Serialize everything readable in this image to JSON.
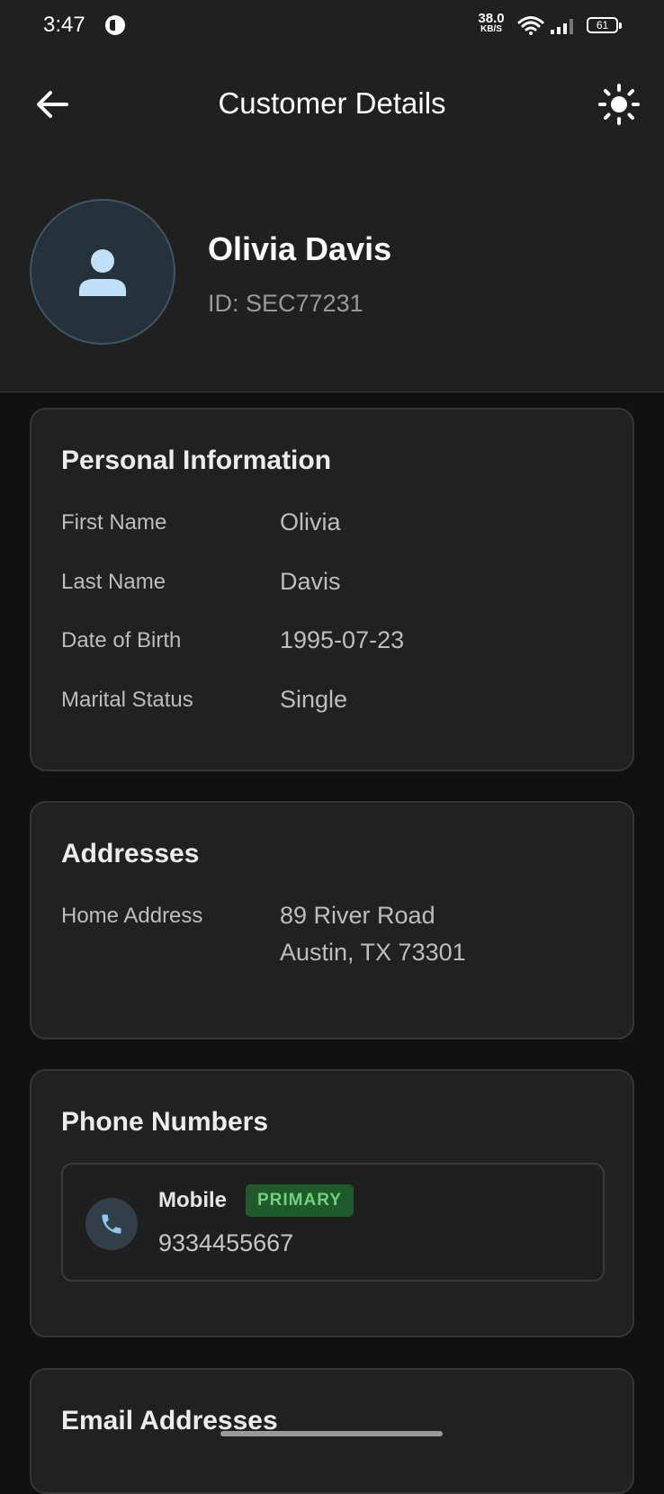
{
  "status_bar": {
    "time": "3:47",
    "net_speed": "38.0",
    "net_speed_unit": "KB/S",
    "battery": "61"
  },
  "app_bar": {
    "title": "Customer Details",
    "back_icon": "arrow-left-icon",
    "theme_icon": "sun-icon"
  },
  "customer": {
    "name": "Olivia Davis",
    "id": "ID: SEC77231",
    "avatar_icon": "person-icon"
  },
  "personal_info": {
    "title": "Personal Information",
    "rows": [
      {
        "label": "First Name",
        "value": "Olivia"
      },
      {
        "label": "Last Name",
        "value": "Davis"
      },
      {
        "label": "Date of Birth",
        "value": "1995-07-23"
      },
      {
        "label": "Marital Status",
        "value": "Single"
      }
    ]
  },
  "addresses": {
    "title": "Addresses",
    "items": [
      {
        "label": "Home Address",
        "line1": "89 River Road",
        "line2": "Austin, TX 73301"
      }
    ]
  },
  "phones": {
    "title": "Phone Numbers",
    "items": [
      {
        "type": "Mobile",
        "badge": "PRIMARY",
        "number": "9334455667",
        "icon": "phone-icon"
      }
    ]
  },
  "emails": {
    "title": "Email Addresses"
  },
  "colors": {
    "background": "#111111",
    "surface": "#212121",
    "badge_bg": "#1f5a2a",
    "badge_text": "#72d07f",
    "avatar_icon": "#bfe0f7"
  }
}
